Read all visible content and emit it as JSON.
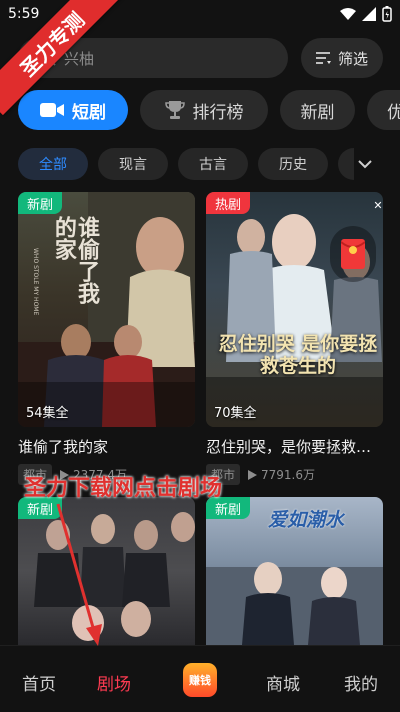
{
  "status": {
    "time": "5:59"
  },
  "ribbon": {
    "text": "圣力专测"
  },
  "search": {
    "placeholder": "兴柚"
  },
  "filter": {
    "label": "筛选"
  },
  "categories": [
    {
      "label": "短剧",
      "active": true
    },
    {
      "label": "排行榜"
    },
    {
      "label": "新剧"
    },
    {
      "label": "优"
    }
  ],
  "subcategories": [
    {
      "label": "全部",
      "active": true
    },
    {
      "label": "现言"
    },
    {
      "label": "古言"
    },
    {
      "label": "历史"
    }
  ],
  "cards": [
    {
      "badge": "新剧",
      "episodes": "54集全",
      "title": "谁偷了我的家",
      "genre": "都市",
      "views": "2377.4万",
      "poster_text": "谁偷了我的家",
      "poster_sub": "WHO STOLE MY HOME"
    },
    {
      "badge": "热剧",
      "episodes": "70集全",
      "title": "忍住别哭，是你要拯救苍...",
      "genre": "都市",
      "views": "7791.6万",
      "poster_text": "忍住别哭 是你要拯救苍生的"
    },
    {
      "badge": "新剧"
    },
    {
      "badge": "新剧",
      "poster_text": "爱如潮水"
    }
  ],
  "overlay": {
    "text": "圣力下载网点击剧场"
  },
  "nav": {
    "home": "首页",
    "theater": "剧场",
    "earn": "赚钱",
    "mall": "商城",
    "mine": "我的"
  },
  "colors": {
    "accent_blue": "#1a86ff",
    "badge_green": "#12b87c",
    "badge_red": "#f0353d",
    "nav_active": "#ff3b52"
  }
}
